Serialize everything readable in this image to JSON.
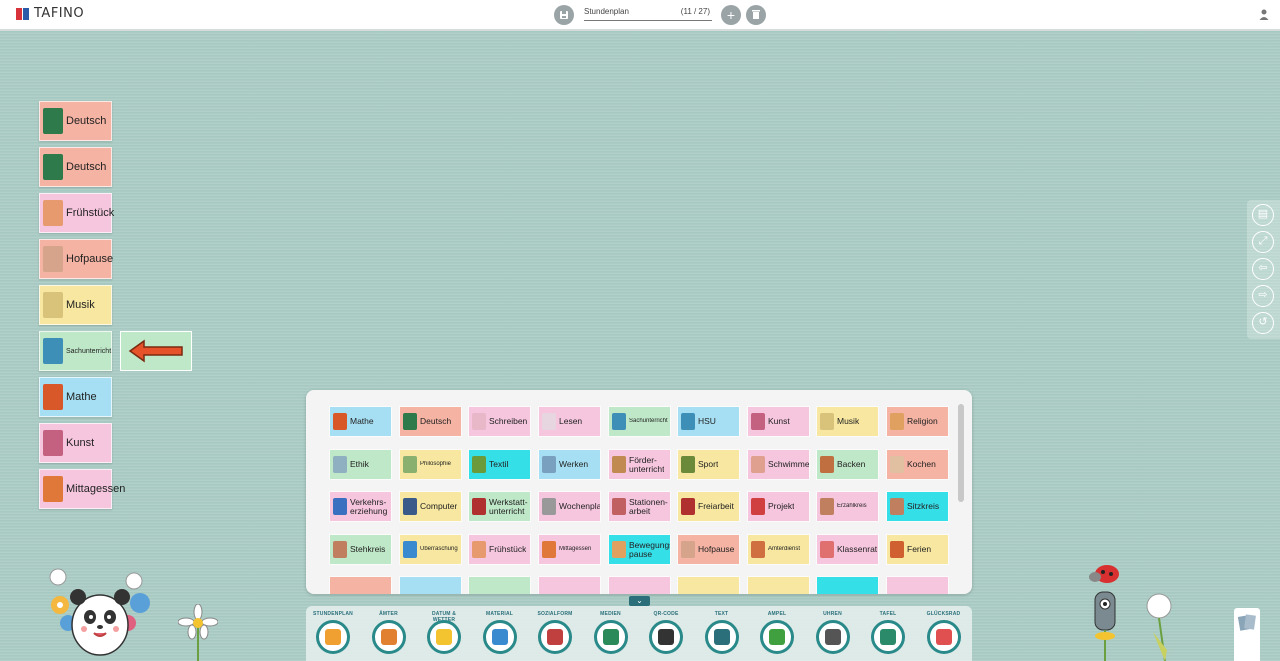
{
  "app": {
    "brand": "TAFINO",
    "plan_name": "Stundenplan",
    "plan_count": "(11 / 27)"
  },
  "toolbar": {
    "save_icon": "save-icon",
    "add_icon": "plus-icon",
    "delete_icon": "trash-icon",
    "user_icon": "user-icon"
  },
  "schedule": [
    {
      "label": "Deutsch",
      "color": "#f5b3a3",
      "icon_color": "#2f7a4a"
    },
    {
      "label": "Deutsch",
      "color": "#f5b3a3",
      "icon_color": "#2f7a4a"
    },
    {
      "label": "Frühstück",
      "color": "#f6c6df",
      "icon_color": "#e79a6d"
    },
    {
      "label": "Hofpause",
      "color": "#f5b3a3",
      "icon_color": "#d6a48a"
    },
    {
      "label": "Musik",
      "color": "#f7e7a0",
      "icon_color": "#d9c27a"
    },
    {
      "label": "Sachunterricht",
      "color": "#bfe8c8",
      "icon_color": "#3d8fb8"
    },
    {
      "label": "Mathe",
      "color": "#a6dff3",
      "icon_color": "#d9582a"
    },
    {
      "label": "Kunst",
      "color": "#f6c6df",
      "icon_color": "#c46080"
    },
    {
      "label": "Mittagessen",
      "color": "#f6c6df",
      "icon_color": "#e0783a"
    }
  ],
  "pointer_arrow": {
    "color": "#e6522a"
  },
  "side_tools": [
    {
      "icon": "clipboard-icon"
    },
    {
      "icon": "fullscreen-icon"
    },
    {
      "icon": "arrow-left-icon"
    },
    {
      "icon": "arrow-right-icon"
    },
    {
      "icon": "refresh-icon"
    }
  ],
  "tiles": [
    {
      "label": "Mathe",
      "color": "#a6dff3",
      "icon_color": "#d9582a"
    },
    {
      "label": "Deutsch",
      "color": "#f5b3a3",
      "icon_color": "#2f7a4a"
    },
    {
      "label": "Schreiben",
      "color": "#f6c6df",
      "icon_color": "#e8b7c8"
    },
    {
      "label": "Lesen",
      "color": "#f6c6df",
      "icon_color": "#e7d6e0"
    },
    {
      "label": "Sachunterricht",
      "color": "#bfe8c8",
      "icon_color": "#3d8fb8"
    },
    {
      "label": "HSU",
      "color": "#a6dff3",
      "icon_color": "#3d8fb8"
    },
    {
      "label": "Kunst",
      "color": "#f6c6df",
      "icon_color": "#c46080"
    },
    {
      "label": "Musik",
      "color": "#f7e7a0",
      "icon_color": "#d9c27a"
    },
    {
      "label": "Religion",
      "color": "#f5b3a3",
      "icon_color": "#e0a060"
    },
    {
      "label": "Ethik",
      "color": "#bfe8c8",
      "icon_color": "#8fb0c0"
    },
    {
      "label": "Philosophie",
      "color": "#f7e7a0",
      "icon_color": "#8ab070"
    },
    {
      "label": "Textil",
      "color": "#35dfe8",
      "icon_color": "#6a9a3a"
    },
    {
      "label": "Werken",
      "color": "#a6dff3",
      "icon_color": "#7aa0c0"
    },
    {
      "label": "Förder-\nunterricht",
      "color": "#f6c6df",
      "icon_color": "#c08a50"
    },
    {
      "label": "Sport",
      "color": "#f7e7a0",
      "icon_color": "#6a8a3a"
    },
    {
      "label": "Schwimmen",
      "color": "#f6c6df",
      "icon_color": "#e0a090"
    },
    {
      "label": "Backen",
      "color": "#bfe8c8",
      "icon_color": "#c07040"
    },
    {
      "label": "Kochen",
      "color": "#f5b3a3",
      "icon_color": "#e0c0a0"
    },
    {
      "label": "Verkehrs-\nerziehung",
      "color": "#f6c6df",
      "icon_color": "#3a70c0"
    },
    {
      "label": "Computer",
      "color": "#f7e7a0",
      "icon_color": "#3a5a8a"
    },
    {
      "label": "Werkstatt-\nunterricht",
      "color": "#bfe8c8",
      "icon_color": "#b03030"
    },
    {
      "label": "Wochenplan",
      "color": "#f6c6df",
      "icon_color": "#999999"
    },
    {
      "label": "Stationen-\narbeit",
      "color": "#f6c6df",
      "icon_color": "#c06060"
    },
    {
      "label": "Freiarbeit",
      "color": "#f7e7a0",
      "icon_color": "#b03030"
    },
    {
      "label": "Projekt",
      "color": "#f6c6df",
      "icon_color": "#d04040"
    },
    {
      "label": "Erzählkreis",
      "color": "#f6c6df",
      "icon_color": "#c08060"
    },
    {
      "label": "Sitzkreis",
      "color": "#35dfe8",
      "icon_color": "#c08060"
    },
    {
      "label": "Stehkreis",
      "color": "#bfe8c8",
      "icon_color": "#c08060"
    },
    {
      "label": "Überraschung",
      "color": "#f7e7a0",
      "icon_color": "#3a8ad0"
    },
    {
      "label": "Frühstück",
      "color": "#f6c6df",
      "icon_color": "#e79a6d"
    },
    {
      "label": "Mittagessen",
      "color": "#f6c6df",
      "icon_color": "#e0783a"
    },
    {
      "label": "Bewegungs-\npause",
      "color": "#35dfe8",
      "icon_color": "#e0a060"
    },
    {
      "label": "Hofpause",
      "color": "#f5b3a3",
      "icon_color": "#d6a48a"
    },
    {
      "label": "Ämterdienst",
      "color": "#f7e7a0",
      "icon_color": "#d07040"
    },
    {
      "label": "Klassenrat",
      "color": "#f6c6df",
      "icon_color": "#e07070"
    },
    {
      "label": "Ferien",
      "color": "#f7e7a0",
      "icon_color": "#d06030"
    }
  ],
  "dock": [
    {
      "label": "STUNDENPLAN",
      "icon_color": "#f0a030",
      "icon": "calendar-icon"
    },
    {
      "label": "ÄMTER",
      "icon_color": "#e08030",
      "icon": "sponge-icon"
    },
    {
      "label": "DATUM & WETTER",
      "icon_color": "#f4c430",
      "icon": "sun-icon"
    },
    {
      "label": "MATERIAL",
      "icon_color": "#3a8ad0",
      "icon": "scissors-icon"
    },
    {
      "label": "SOZIALFORM",
      "icon_color": "#c04040",
      "icon": "group-icon"
    },
    {
      "label": "MEDIEN",
      "icon_color": "#2a8a5a",
      "icon": "folder-icon"
    },
    {
      "label": "QR-CODE",
      "icon_color": "#333333",
      "icon": "qr-icon"
    },
    {
      "label": "TEXT",
      "icon_color": "#2a6f7a",
      "icon": "text-icon"
    },
    {
      "label": "AMPEL",
      "icon_color": "#40a040",
      "icon": "traffic-light-icon"
    },
    {
      "label": "UHREN",
      "icon_color": "#555555",
      "icon": "clock-icon"
    },
    {
      "label": "TAFEL",
      "icon_color": "#2a8a6a",
      "icon": "board-icon"
    },
    {
      "label": "GLÜCKSRAD",
      "icon_color": "#e05050",
      "icon": "wheel-icon"
    }
  ]
}
